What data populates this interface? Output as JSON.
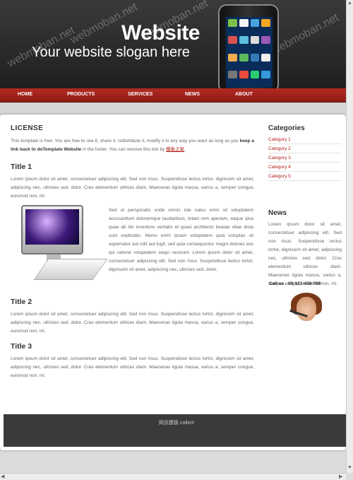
{
  "header": {
    "title": "Website",
    "slogan": "Your website slogan here",
    "watermark": "webmoban.net"
  },
  "nav": [
    "HOME",
    "PRODUCTS",
    "SERVICES",
    "NEWS",
    "ABOUT"
  ],
  "main": {
    "license_heading": "LICENSE",
    "license_text_1": "This template is free. You are free to use it, share it, redistribute it, modify it in any way you want as long as you ",
    "license_bold": "keep a link back to doTemplate Website",
    "license_text_2": " in the footer. You can remove this link by ",
    "license_link": "模板之家",
    "license_end": ".",
    "title1": "Title 1",
    "para1": "Lorem ipsum dolor sit amet, consectetuer adipiscing elit. Sed non risus. Suspendisse lectus tortor, dignissim sit amet, adipiscing nec, ultricies sed, dolor. Cras elementum ultrices diam. Maecenas ligula massa, varius a, semper congue, euismod non, mi.",
    "para_wrap": "Sed ut perspiciatis unde omnis iste natus error sit voluptatem accusantium doloremque laudantium, totam rem aperiam, eaque ipsa quae ab illo inventore veritatis et quasi architecto beatae vitae dicta sunt explicabo. Nemo enim ipsam voluptatem quia voluptas sit aspernatur aut odit aut fugit, sed quia consequuntur magni dolores eos qui ratione voluptatem sequi nesciunt. Lorem ipsum dolor sit amet, consectetuer adipiscing elit. Sed non risus. Suspendisse lectus tortor, dignissim sit amet, adipiscing nec, ultricies sed, dolor.",
    "title2": "Title 2",
    "para2": "Lorem ipsum dolor sit amet, consectetuer adipiscing elit. Sed non risus. Suspendisse lectus tortor, dignissim sit amet, adipiscing nec, ultricies sed, dolor. Cras elementum ultrices diam. Maecenas ligula massa, varius a, semper congue, euismod non, mi.",
    "title3": "Title 3",
    "para3": "Lorem ipsum dolor sit amet, consectetuer adipiscing elit. Sed non risus. Suspendisse lectus tortor, dignissim sit amet, adipiscing nec, ultricies sed, dolor. Cras elementum ultrices diam. Maecenas ligula massa, varius a, semper congue, euismod non, mi."
  },
  "sidebar": {
    "categories_heading": "Categories",
    "categories": [
      "Category 1",
      "Category 2",
      "Category 3",
      "Category 4",
      "Category 5"
    ],
    "news_heading": "News",
    "news_text": "Lorem ipsum dolor sit amet, consectetuer adipiscing elit. Sed non risus. Suspendisse lectus tortor, dignissim sit amet, adipiscing nec, ultricies sed, dolor. Cras elementum ultrices diam. Maecenas ligula massa, varius a, semper congue, euismod non, mi.",
    "call_label": "Call us : 00-123-456-789"
  },
  "footer": {
    "text": "网页模板 collect"
  },
  "colors": {
    "nav_red": "#a3231c",
    "link_red": "#b01b15",
    "header_dark": "#2b2b2b"
  }
}
